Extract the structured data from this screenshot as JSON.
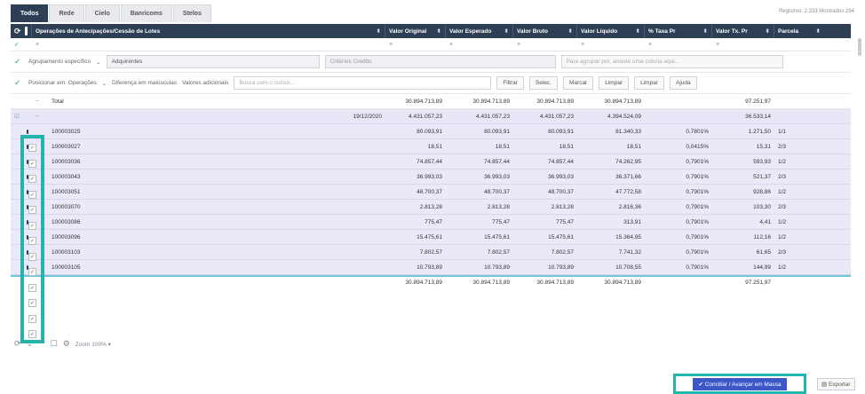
{
  "tabs": [
    {
      "label": "Todos",
      "active": true
    },
    {
      "label": "Rede"
    },
    {
      "label": "Cielo"
    },
    {
      "label": "Banricoms"
    },
    {
      "label": "Stelos"
    }
  ],
  "records_text": "Registros: 2.333  Mostrados 294",
  "header": {
    "col_main": "Operações de Antecipações/Cessão de Lotes",
    "col_orig": "Valor Original",
    "col_exp": "Valor Esperado",
    "col_bruto": "Valor Bruto",
    "col_liq": "Valor Líquido",
    "col_taxa": "% Taxa Pr",
    "col_pr": "Valor Tx. Pr",
    "col_parc": "Parcela"
  },
  "filter_marks": [
    "×",
    "×",
    "×",
    "×",
    "×",
    "×",
    "×"
  ],
  "bar1": {
    "mode": "Agrupamento específico",
    "group": "Adquirentes",
    "criteria": "Critérios Credito",
    "note": "Para agrupar por, arraste uma coluna aqui..."
  },
  "bar2": {
    "select": "Posicionar em: Operações",
    "select2": "Diferença em maiúsculas",
    "lbl": "Valores adicionais",
    "search_placeholder": "Busca com o cursor...",
    "btns": [
      "Filtrar",
      "Selec.",
      "Marcar",
      "Limpar",
      "Limpar",
      "Ajuda"
    ]
  },
  "rows": [
    {
      "kind": "tot",
      "label": "Total",
      "orig": "30.894.713,89",
      "exp": "30.894.713,89",
      "bruto": "30.894.713,89",
      "liq": "30.894.713,89",
      "taxa": "",
      "pr": "97.251,97",
      "parc": ""
    },
    {
      "kind": "grp",
      "label": "",
      "date": "19/12/2020",
      "orig": "4.431.057,23",
      "exp": "4.431.057,23",
      "bruto": "4.431.057,23",
      "liq": "4.394.524,09",
      "taxa": "",
      "pr": "36.533,14",
      "parc": ""
    },
    {
      "kind": "data",
      "label": "100003025",
      "orig": "80.093,91",
      "exp": "80.093,91",
      "bruto": "80.093,91",
      "liq": "81.340,33",
      "taxa": "0,7801%",
      "pr": "1.271,50",
      "parc": "1/1"
    },
    {
      "kind": "data",
      "label": "100003027",
      "orig": "18,51",
      "exp": "18,51",
      "bruto": "18,51",
      "liq": "18,51",
      "taxa": "0,0415%",
      "pr": "15,31",
      "parc": "2/3"
    },
    {
      "kind": "data",
      "label": "100003036",
      "orig": "74.857,44",
      "exp": "74.857,44",
      "bruto": "74.857,44",
      "liq": "74.262,95",
      "taxa": "0,7901%",
      "pr": "593,93",
      "parc": "1/2"
    },
    {
      "kind": "data",
      "label": "100003043",
      "orig": "36.993,03",
      "exp": "36.993,03",
      "bruto": "36.993,03",
      "liq": "36.371,66",
      "taxa": "0,7901%",
      "pr": "521,37",
      "parc": "2/3"
    },
    {
      "kind": "data",
      "label": "100003051",
      "orig": "48.700,37",
      "exp": "48.700,37",
      "bruto": "48.700,37",
      "liq": "47.772,58",
      "taxa": "0,7901%",
      "pr": "928,86",
      "parc": "1/2"
    },
    {
      "kind": "data",
      "label": "100003070",
      "orig": "2.813,28",
      "exp": "2.813,28",
      "bruto": "2.813,28",
      "liq": "2.816,36",
      "taxa": "0,7901%",
      "pr": "103,30",
      "parc": "2/3"
    },
    {
      "kind": "data",
      "label": "100003086",
      "orig": "775,47",
      "exp": "775,47",
      "bruto": "775,47",
      "liq": "313,91",
      "taxa": "0,7901%",
      "pr": "4,41",
      "parc": "1/2"
    },
    {
      "kind": "data",
      "label": "100003096",
      "orig": "15.475,61",
      "exp": "15.475,61",
      "bruto": "15.475,61",
      "liq": "15.364,95",
      "taxa": "0,7901%",
      "pr": "112,16",
      "parc": "1/2"
    },
    {
      "kind": "data",
      "label": "100003103",
      "orig": "7.802,57",
      "exp": "7.802,57",
      "bruto": "7.802,57",
      "liq": "7.741,32",
      "taxa": "0,7901%",
      "pr": "61,65",
      "parc": "2/3"
    },
    {
      "kind": "data",
      "label": "100003105",
      "orig": "10.793,89",
      "exp": "10.793,89",
      "bruto": "10.793,89",
      "liq": "10.708,55",
      "taxa": "0,7901%",
      "pr": "144,99",
      "parc": "1/2"
    }
  ],
  "footer": {
    "orig": "30.894.713,89",
    "exp": "30.894.713,89",
    "bruto": "30.894.713,89",
    "liq": "30.894.713,89",
    "pr": "97.251,97"
  },
  "zoom": "Zoom 100% ▾",
  "actions": {
    "conciliar": "✔ Conciliar / Avançar em Massa",
    "export": "▤ Exportar"
  }
}
